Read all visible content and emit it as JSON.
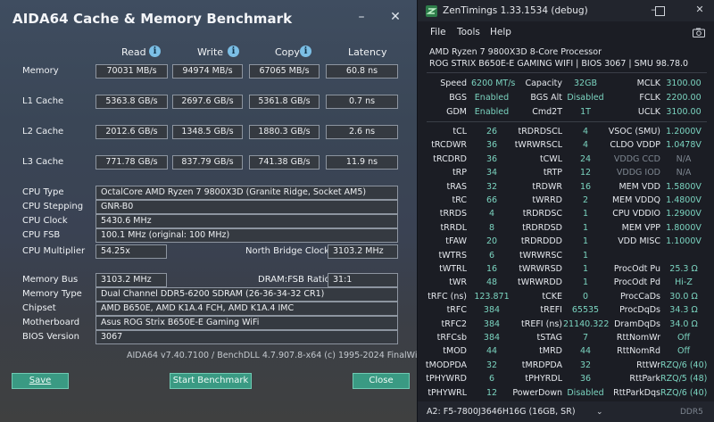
{
  "aida": {
    "title": "AIDA64 Cache & Memory Benchmark",
    "headers": {
      "read": "Read",
      "write": "Write",
      "copy": "Copy",
      "latency": "Latency"
    },
    "rows": [
      {
        "label": "Memory",
        "read": "70031 MB/s",
        "write": "94974 MB/s",
        "copy": "67065 MB/s",
        "latency": "60.8 ns"
      },
      {
        "label": "L1 Cache",
        "read": "5363.8 GB/s",
        "write": "2697.6 GB/s",
        "copy": "5361.8 GB/s",
        "latency": "0.7 ns"
      },
      {
        "label": "L2 Cache",
        "read": "2012.6 GB/s",
        "write": "1348.5 GB/s",
        "copy": "1880.3 GB/s",
        "latency": "2.6 ns"
      },
      {
        "label": "L3 Cache",
        "read": "771.78 GB/s",
        "write": "837.79 GB/s",
        "copy": "741.38 GB/s",
        "latency": "11.9 ns"
      }
    ],
    "cpu": {
      "type_label": "CPU Type",
      "type": "OctalCore AMD Ryzen 7 9800X3D  (Granite Ridge, Socket AM5)",
      "stepping_label": "CPU Stepping",
      "stepping": "GNR-B0",
      "clock_label": "CPU Clock",
      "clock": "5430.6 MHz",
      "fsb_label": "CPU FSB",
      "fsb": "100.1 MHz  (original: 100 MHz)",
      "mult_label": "CPU Multiplier",
      "mult": "54.25x",
      "nb_label": "North Bridge Clock",
      "nb": "3103.2 MHz"
    },
    "mem": {
      "bus_label": "Memory Bus",
      "bus": "3103.2 MHz",
      "ratio_label": "DRAM:FSB Ratio",
      "ratio": "31:1",
      "type_label": "Memory Type",
      "type": "Dual Channel DDR5-6200 SDRAM  (26-36-34-32 CR1)",
      "chipset_label": "Chipset",
      "chipset": "AMD B650E, AMD K1A.4 FCH, AMD K1A.4 IMC",
      "mobo_label": "Motherboard",
      "mobo": "Asus ROG Strix B650E-E Gaming WiFi",
      "bios_label": "BIOS Version",
      "bios": "3067"
    },
    "footer": "AIDA64 v7.40.7100 / BenchDLL 4.7.907.8-x64  (c) 1995-2024 FinalWire Ltd.",
    "buttons": {
      "save": "Save",
      "start": "Start Benchmark",
      "close": "Close"
    }
  },
  "zen": {
    "title": "ZenTimings 1.33.1534 (debug)",
    "menu": [
      "File",
      "Tools",
      "Help"
    ],
    "cpu_name": "AMD Ryzen 7 9800X3D 8-Core Processor",
    "board": "ROG STRIX B650E-E GAMING WIFI | BIOS 3067 | SMU 98.78.0",
    "top": [
      [
        "Speed",
        "6200 MT/s",
        "Capacity",
        "32GB",
        "MCLK",
        "3100.00"
      ],
      [
        "BGS",
        "Enabled",
        "BGS Alt",
        "Disabled",
        "FCLK",
        "2200.00"
      ],
      [
        "GDM",
        "Enabled",
        "Cmd2T",
        "1T",
        "UCLK",
        "3100.00"
      ]
    ],
    "timings": [
      [
        "tCL",
        "26",
        "tRDRDSCL",
        "4",
        "VSOC (SMU)",
        "1.2000V"
      ],
      [
        "tRCDWR",
        "36",
        "tWRWRSCL",
        "4",
        "CLDO VDDP",
        "1.0478V"
      ],
      [
        "tRCDRD",
        "36",
        "tCWL",
        "24",
        "VDDG CCD",
        "N/A"
      ],
      [
        "tRP",
        "34",
        "tRTP",
        "12",
        "VDDG IOD",
        "N/A"
      ],
      [
        "tRAS",
        "32",
        "tRDWR",
        "16",
        "MEM VDD",
        "1.5800V"
      ],
      [
        "tRC",
        "66",
        "tWRRD",
        "2",
        "MEM VDDQ",
        "1.4800V"
      ],
      [
        "tRRDS",
        "4",
        "tRDRDSC",
        "1",
        "CPU VDDIO",
        "1.2900V"
      ],
      [
        "tRRDL",
        "8",
        "tRDRDSD",
        "1",
        "MEM VPP",
        "1.8000V"
      ],
      [
        "tFAW",
        "20",
        "tRDRDDD",
        "1",
        "VDD MISC",
        "1.1000V"
      ],
      [
        "tWTRS",
        "6",
        "tWRWRSC",
        "1",
        "",
        ""
      ],
      [
        "tWTRL",
        "16",
        "tWRWRSD",
        "1",
        "ProcOdt Pu",
        "25.3 Ω"
      ],
      [
        "tWR",
        "48",
        "tWRWRDD",
        "1",
        "ProcOdt Pd",
        "Hi-Z"
      ],
      [
        "tRFC (ns)",
        "123.871",
        "tCKE",
        "0",
        "ProcCaDs",
        "30.0 Ω"
      ],
      [
        "tRFC",
        "384",
        "tREFI",
        "65535",
        "ProcDqDs",
        "34.3 Ω"
      ],
      [
        "tRFC2",
        "384",
        "tREFI (ns)",
        "21140.322",
        "DramDqDs",
        "34.0 Ω"
      ],
      [
        "tRFCsb",
        "384",
        "tSTAG",
        "7",
        "RttNomWr",
        "Off"
      ],
      [
        "tMOD",
        "44",
        "tMRD",
        "44",
        "RttNomRd",
        "Off"
      ],
      [
        "tMODPDA",
        "32",
        "tMRDPDA",
        "32",
        "RttWr",
        "RZQ/6 (40)"
      ],
      [
        "tPHYWRD",
        "6",
        "tPHYRDL",
        "36",
        "RttPark",
        "RZQ/5 (48)"
      ],
      [
        "tPHYWRL",
        "12",
        "PowerDown",
        "Disabled",
        "RttParkDqs",
        "RZQ/6 (40)"
      ]
    ],
    "dimm": "A2: F5-7800J3646H16G (16GB, SR)",
    "ddr": "DDR5",
    "colors": {
      "value": "#7bd4c0",
      "na": "#7e8791"
    }
  }
}
